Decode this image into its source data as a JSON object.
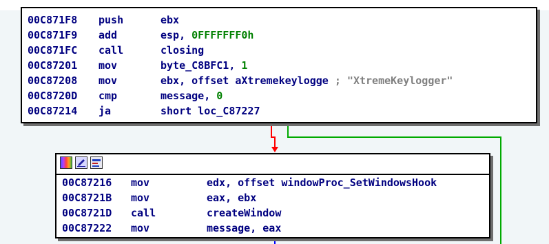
{
  "colors": {
    "address": "#000080",
    "mnemonic": "#000080",
    "operand": "#000080",
    "number": "#008000",
    "comment": "#808080",
    "edge_true": "#ff0000",
    "edge_false": "#00aa00",
    "edge_flow": "#0000ff",
    "canvas_bg": "#f1f6f8"
  },
  "block1": {
    "lines": [
      {
        "addr": "00C871F8",
        "mnemonic": "push",
        "operand": "ebx",
        "number": "",
        "comment": ""
      },
      {
        "addr": "00C871F9",
        "mnemonic": "add",
        "operand": "esp, ",
        "number": "0FFFFFFF0h",
        "comment": ""
      },
      {
        "addr": "00C871FC",
        "mnemonic": "call",
        "operand": "closing",
        "number": "",
        "comment": ""
      },
      {
        "addr": "00C87201",
        "mnemonic": "mov",
        "operand": "byte_C8BFC1, ",
        "number": "1",
        "comment": ""
      },
      {
        "addr": "00C87208",
        "mnemonic": "mov",
        "operand": "ebx, offset aXtremekeylogge",
        "number": "",
        "comment": " ; \"XtremeKeylogger\""
      },
      {
        "addr": "00C8720D",
        "mnemonic": "cmp",
        "operand": "message, ",
        "number": "0",
        "comment": ""
      },
      {
        "addr": "00C87214",
        "mnemonic": "ja",
        "operand": "short loc_C87227",
        "number": "",
        "comment": ""
      }
    ]
  },
  "block2": {
    "toolbar": {
      "icons": [
        "graph-colors-icon",
        "edit-icon",
        "xref-icon"
      ]
    },
    "lines": [
      {
        "addr": "00C87216",
        "mnemonic": "mov",
        "operand": "edx, offset windowProc_SetWindowsHook"
      },
      {
        "addr": "00C8721B",
        "mnemonic": "mov",
        "operand": "eax, ebx"
      },
      {
        "addr": "00C8721D",
        "mnemonic": "call",
        "operand": "createWindow"
      },
      {
        "addr": "00C87222",
        "mnemonic": "mov",
        "operand": "message, eax"
      }
    ]
  }
}
